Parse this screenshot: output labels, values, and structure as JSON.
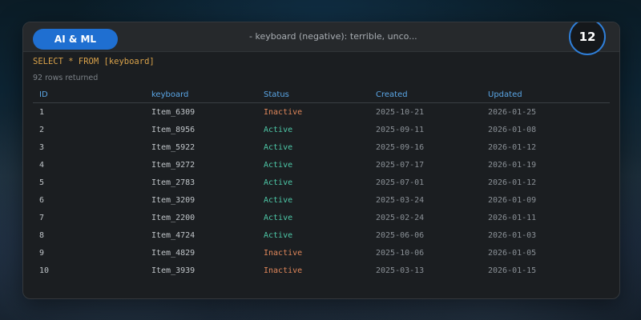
{
  "header": {
    "category": "AI & ML",
    "subtitle": "- keyboard (negative): terrible, unco...",
    "badge": "12"
  },
  "query": "SELECT * FROM [keyboard]",
  "row_count_text": "92 rows returned",
  "table": {
    "columns": [
      "ID",
      "keyboard",
      "Status",
      "Created",
      "Updated"
    ],
    "rows": [
      {
        "id": "1",
        "name": "Item_6309",
        "status": "Inactive",
        "created": "2025-10-21",
        "updated": "2026-01-25"
      },
      {
        "id": "2",
        "name": "Item_8956",
        "status": "Active",
        "created": "2025-09-11",
        "updated": "2026-01-08"
      },
      {
        "id": "3",
        "name": "Item_5922",
        "status": "Active",
        "created": "2025-09-16",
        "updated": "2026-01-12"
      },
      {
        "id": "4",
        "name": "Item_9272",
        "status": "Active",
        "created": "2025-07-17",
        "updated": "2026-01-19"
      },
      {
        "id": "5",
        "name": "Item_2783",
        "status": "Active",
        "created": "2025-07-01",
        "updated": "2026-01-12"
      },
      {
        "id": "6",
        "name": "Item_3209",
        "status": "Active",
        "created": "2025-03-24",
        "updated": "2026-01-09"
      },
      {
        "id": "7",
        "name": "Item_2200",
        "status": "Active",
        "created": "2025-02-24",
        "updated": "2026-01-11"
      },
      {
        "id": "8",
        "name": "Item_4724",
        "status": "Active",
        "created": "2025-06-06",
        "updated": "2026-01-03"
      },
      {
        "id": "9",
        "name": "Item_4829",
        "status": "Inactive",
        "created": "2025-10-06",
        "updated": "2026-01-05"
      },
      {
        "id": "10",
        "name": "Item_3939",
        "status": "Inactive",
        "created": "2025-03-13",
        "updated": "2026-01-15"
      }
    ]
  },
  "colors": {
    "accent": "#1f6fd1",
    "header_text": "#5aa6e6",
    "query_text": "#d9a24a",
    "status_active": "#4ec9a8",
    "status_inactive": "#e0875a"
  }
}
